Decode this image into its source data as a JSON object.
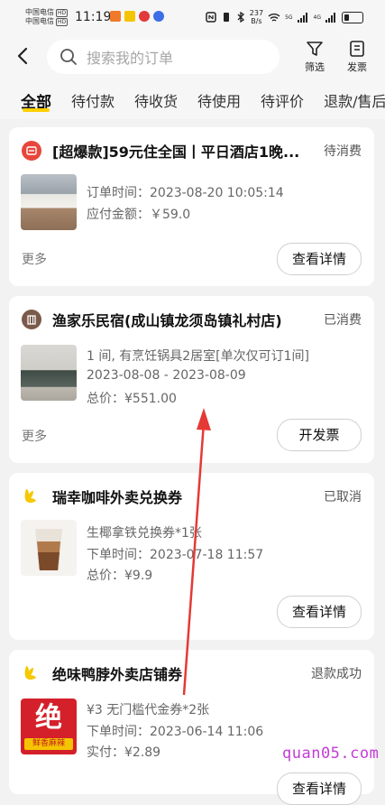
{
  "status_bar": {
    "carrier1": "中国电信",
    "carrier2": "中国电信",
    "hd": "HD",
    "time": "11:19",
    "net_speed": "237",
    "net_unit": "B/s",
    "sig1": "5G",
    "sig2": "4G"
  },
  "header": {
    "search_placeholder": "搜索我的订单",
    "filter_label": "筛选",
    "invoice_label": "发票"
  },
  "tabs": [
    "全部",
    "待付款",
    "待收货",
    "待使用",
    "待评价",
    "退款/售后"
  ],
  "orders": [
    {
      "title": "[超爆款]59元住全国丨平日酒店1晚...",
      "status": "待消费",
      "lines": [
        "订单时间：2023-08-20 10:05:14",
        "应付金额：￥59.0"
      ],
      "more": "更多",
      "button": "查看详情"
    },
    {
      "title": "渔家乐民宿(成山镇龙须岛镇礼村店)",
      "status": "已消费",
      "lines": [
        "1 间, 有烹饪锅具2居室[单次仅可订1间]",
        "2023-08-08 - 2023-08-09",
        "总价：¥551.00"
      ],
      "more": "更多",
      "button": "开发票"
    },
    {
      "title": "瑞幸咖啡外卖兑换券",
      "status": "已取消",
      "lines": [
        "生椰拿铁兑换券*1张",
        "下单时间：2023-07-18 11:57",
        "总价：¥9.9"
      ],
      "button": "查看详情"
    },
    {
      "title": "绝味鸭脖外卖店铺券",
      "status": "退款成功",
      "lines": [
        "¥3 无门槛代金券*2张",
        "下单时间：2023-06-14 11:06",
        "实付：¥2.89"
      ],
      "thumb_text": "绝",
      "thumb_caption": "鲜香麻辣",
      "button": "查看详情"
    }
  ],
  "watermark": "quan05.com",
  "colors": {
    "accent_yellow": "#ffd000",
    "hotel_icon": "#e8463c",
    "homestay_icon": "#7a5a4a",
    "annotation_arrow": "#e53935",
    "watermark": "#c33cd6"
  }
}
